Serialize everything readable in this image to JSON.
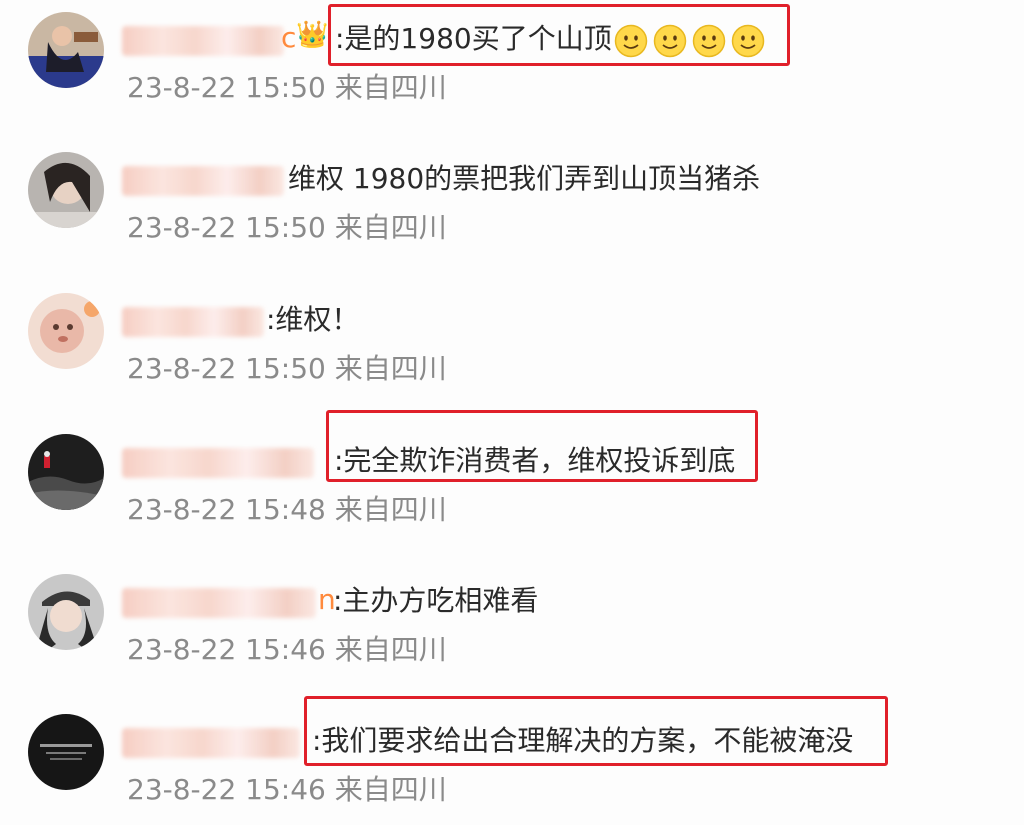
{
  "comments": [
    {
      "name_suffix": "c",
      "text": ":是的1980买了个山顶",
      "emojis": [
        "smiley-icon",
        "smiley-icon",
        "smiley-icon",
        "smiley-icon"
      ],
      "timestamp": "23-8-22 15:50",
      "location": "来自四川",
      "highlighted": true
    },
    {
      "name_suffix": "",
      "text": "维权 1980的票把我们弄到山顶当猪杀",
      "timestamp": "23-8-22 15:50",
      "location": "来自四川",
      "highlighted": false
    },
    {
      "name_suffix": "",
      "text": ":维权！",
      "timestamp": "23-8-22 15:50",
      "location": "来自四川",
      "highlighted": false
    },
    {
      "name_suffix": "",
      "text": ":完全欺诈消费者，维权投诉到底",
      "timestamp": "23-8-22 15:48",
      "location": "来自四川",
      "highlighted": true
    },
    {
      "name_suffix": "n",
      "text": ":主办方吃相难看",
      "timestamp": "23-8-22 15:46",
      "location": "来自四川",
      "highlighted": false
    },
    {
      "name_suffix": "",
      "text": ":我们要求给出合理解决的方案，不能被淹没",
      "timestamp": "23-8-22 15:46",
      "location": "来自四川",
      "highlighted": true
    }
  ],
  "colors": {
    "highlight_border": "#e0202a",
    "timestamp_text": "#8a8a8a",
    "comment_text": "#2a2a2a",
    "name_accent": "#ff8a3d"
  }
}
